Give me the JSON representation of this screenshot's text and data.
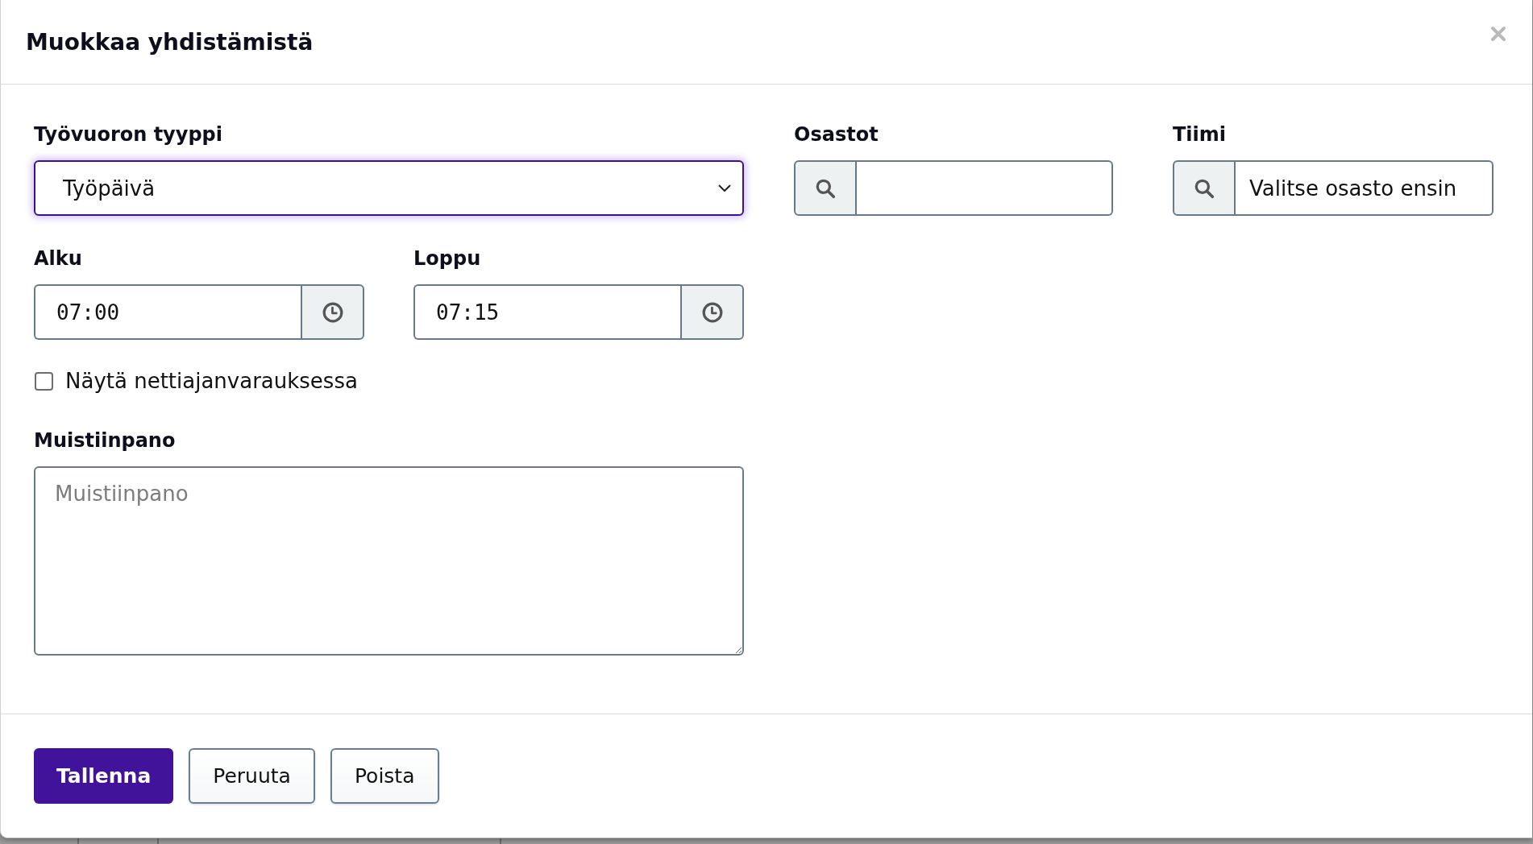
{
  "dialog": {
    "title": "Muokkaa yhdistämistä"
  },
  "form": {
    "shift_type": {
      "label": "Työvuoron tyyppi",
      "value": "Työpäivä",
      "focused": true
    },
    "departments": {
      "label": "Osastot"
    },
    "team": {
      "label": "Tiimi",
      "value": "Valitse osasto ensin"
    },
    "start": {
      "label": "Alku",
      "value": "07:00"
    },
    "end": {
      "label": "Loppu",
      "value": "07:15"
    },
    "online_booking": {
      "label": "Näytä nettiajanvarauksessa",
      "checked": false
    },
    "note": {
      "label": "Muistiinpano",
      "placeholder": "Muistiinpano"
    }
  },
  "buttons": [
    {
      "label": "Tallenna",
      "kind": "primary"
    },
    {
      "label": "Peruuta",
      "kind": "secondary"
    },
    {
      "label": "Poista",
      "kind": "secondary"
    }
  ]
}
